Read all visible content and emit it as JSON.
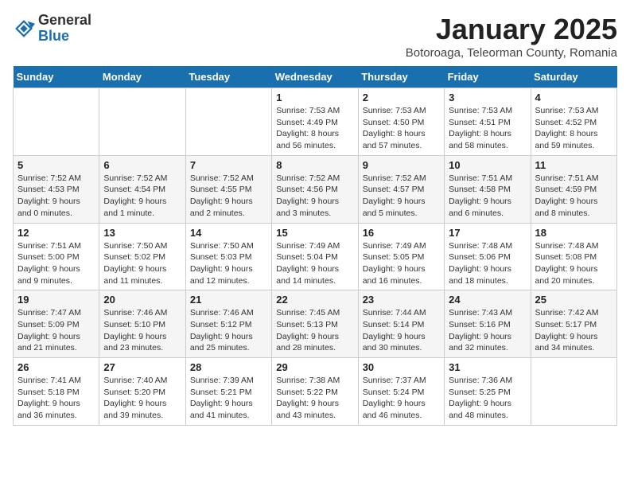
{
  "header": {
    "logo_general": "General",
    "logo_blue": "Blue",
    "title": "January 2025",
    "subtitle": "Botoroaga, Teleorman County, Romania"
  },
  "weekdays": [
    "Sunday",
    "Monday",
    "Tuesday",
    "Wednesday",
    "Thursday",
    "Friday",
    "Saturday"
  ],
  "weeks": [
    [
      {
        "day": "",
        "info": ""
      },
      {
        "day": "",
        "info": ""
      },
      {
        "day": "",
        "info": ""
      },
      {
        "day": "1",
        "info": "Sunrise: 7:53 AM\nSunset: 4:49 PM\nDaylight: 8 hours and 56 minutes."
      },
      {
        "day": "2",
        "info": "Sunrise: 7:53 AM\nSunset: 4:50 PM\nDaylight: 8 hours and 57 minutes."
      },
      {
        "day": "3",
        "info": "Sunrise: 7:53 AM\nSunset: 4:51 PM\nDaylight: 8 hours and 58 minutes."
      },
      {
        "day": "4",
        "info": "Sunrise: 7:53 AM\nSunset: 4:52 PM\nDaylight: 8 hours and 59 minutes."
      }
    ],
    [
      {
        "day": "5",
        "info": "Sunrise: 7:52 AM\nSunset: 4:53 PM\nDaylight: 9 hours and 0 minutes."
      },
      {
        "day": "6",
        "info": "Sunrise: 7:52 AM\nSunset: 4:54 PM\nDaylight: 9 hours and 1 minute."
      },
      {
        "day": "7",
        "info": "Sunrise: 7:52 AM\nSunset: 4:55 PM\nDaylight: 9 hours and 2 minutes."
      },
      {
        "day": "8",
        "info": "Sunrise: 7:52 AM\nSunset: 4:56 PM\nDaylight: 9 hours and 3 minutes."
      },
      {
        "day": "9",
        "info": "Sunrise: 7:52 AM\nSunset: 4:57 PM\nDaylight: 9 hours and 5 minutes."
      },
      {
        "day": "10",
        "info": "Sunrise: 7:51 AM\nSunset: 4:58 PM\nDaylight: 9 hours and 6 minutes."
      },
      {
        "day": "11",
        "info": "Sunrise: 7:51 AM\nSunset: 4:59 PM\nDaylight: 9 hours and 8 minutes."
      }
    ],
    [
      {
        "day": "12",
        "info": "Sunrise: 7:51 AM\nSunset: 5:00 PM\nDaylight: 9 hours and 9 minutes."
      },
      {
        "day": "13",
        "info": "Sunrise: 7:50 AM\nSunset: 5:02 PM\nDaylight: 9 hours and 11 minutes."
      },
      {
        "day": "14",
        "info": "Sunrise: 7:50 AM\nSunset: 5:03 PM\nDaylight: 9 hours and 12 minutes."
      },
      {
        "day": "15",
        "info": "Sunrise: 7:49 AM\nSunset: 5:04 PM\nDaylight: 9 hours and 14 minutes."
      },
      {
        "day": "16",
        "info": "Sunrise: 7:49 AM\nSunset: 5:05 PM\nDaylight: 9 hours and 16 minutes."
      },
      {
        "day": "17",
        "info": "Sunrise: 7:48 AM\nSunset: 5:06 PM\nDaylight: 9 hours and 18 minutes."
      },
      {
        "day": "18",
        "info": "Sunrise: 7:48 AM\nSunset: 5:08 PM\nDaylight: 9 hours and 20 minutes."
      }
    ],
    [
      {
        "day": "19",
        "info": "Sunrise: 7:47 AM\nSunset: 5:09 PM\nDaylight: 9 hours and 21 minutes."
      },
      {
        "day": "20",
        "info": "Sunrise: 7:46 AM\nSunset: 5:10 PM\nDaylight: 9 hours and 23 minutes."
      },
      {
        "day": "21",
        "info": "Sunrise: 7:46 AM\nSunset: 5:12 PM\nDaylight: 9 hours and 25 minutes."
      },
      {
        "day": "22",
        "info": "Sunrise: 7:45 AM\nSunset: 5:13 PM\nDaylight: 9 hours and 28 minutes."
      },
      {
        "day": "23",
        "info": "Sunrise: 7:44 AM\nSunset: 5:14 PM\nDaylight: 9 hours and 30 minutes."
      },
      {
        "day": "24",
        "info": "Sunrise: 7:43 AM\nSunset: 5:16 PM\nDaylight: 9 hours and 32 minutes."
      },
      {
        "day": "25",
        "info": "Sunrise: 7:42 AM\nSunset: 5:17 PM\nDaylight: 9 hours and 34 minutes."
      }
    ],
    [
      {
        "day": "26",
        "info": "Sunrise: 7:41 AM\nSunset: 5:18 PM\nDaylight: 9 hours and 36 minutes."
      },
      {
        "day": "27",
        "info": "Sunrise: 7:40 AM\nSunset: 5:20 PM\nDaylight: 9 hours and 39 minutes."
      },
      {
        "day": "28",
        "info": "Sunrise: 7:39 AM\nSunset: 5:21 PM\nDaylight: 9 hours and 41 minutes."
      },
      {
        "day": "29",
        "info": "Sunrise: 7:38 AM\nSunset: 5:22 PM\nDaylight: 9 hours and 43 minutes."
      },
      {
        "day": "30",
        "info": "Sunrise: 7:37 AM\nSunset: 5:24 PM\nDaylight: 9 hours and 46 minutes."
      },
      {
        "day": "31",
        "info": "Sunrise: 7:36 AM\nSunset: 5:25 PM\nDaylight: 9 hours and 48 minutes."
      },
      {
        "day": "",
        "info": ""
      }
    ]
  ]
}
